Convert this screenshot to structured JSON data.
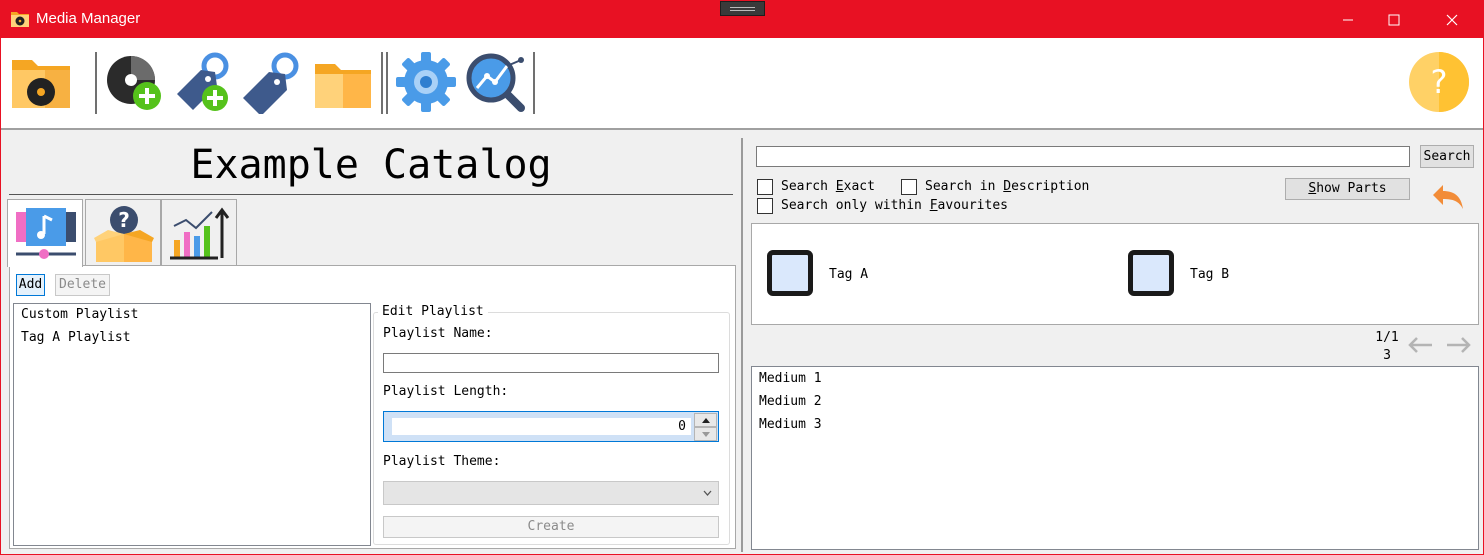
{
  "window": {
    "title": "Media Manager",
    "accent_color": "#e81123"
  },
  "toolbar": {
    "items": [
      {
        "name": "open-catalog",
        "icon": "folder-disc-icon"
      },
      {
        "name": "add-medium",
        "icon": "disc-plus-icon"
      },
      {
        "name": "add-tag",
        "icon": "tag-plus-icon"
      },
      {
        "name": "tags",
        "icon": "tag-icon"
      },
      {
        "name": "open-folder",
        "icon": "folder-icon"
      },
      {
        "name": "settings",
        "icon": "gear-icon"
      },
      {
        "name": "analyze",
        "icon": "magnifier-graph-icon"
      },
      {
        "name": "help",
        "icon": "help-icon"
      }
    ]
  },
  "catalog": {
    "title": "Example Catalog"
  },
  "tabs": [
    {
      "name": "playlists",
      "icon": "playlist-music-icon",
      "active": true
    },
    {
      "name": "unknown-parts",
      "icon": "question-box-icon",
      "active": false
    },
    {
      "name": "statistics",
      "icon": "bar-chart-icon",
      "active": false
    }
  ],
  "playlists": {
    "add_label": "Add",
    "delete_label": "Delete",
    "items": [
      "Custom Playlist",
      "Tag A Playlist"
    ],
    "edit": {
      "legend": "Edit Playlist",
      "name_label": "Playlist Name:",
      "name_value": "",
      "length_label": "Playlist Length:",
      "length_value": "0",
      "theme_label": "Playlist Theme:",
      "theme_value": "",
      "create_label": "Create"
    }
  },
  "search": {
    "query": "",
    "button_label": "Search",
    "exact_label_pre": "Search ",
    "exact_label_key": "E",
    "exact_label_post": "xact",
    "desc_label_pre": "Search in ",
    "desc_label_key": "D",
    "desc_label_post": "escription",
    "fav_label_pre": "Search only within ",
    "fav_label_key": "F",
    "fav_label_post": "avourites",
    "show_parts_key": "S",
    "show_parts_rest": "how Parts"
  },
  "tags": [
    {
      "label": "Tag A",
      "checked": false
    },
    {
      "label": "Tag B",
      "checked": false
    }
  ],
  "pager": {
    "line1": "1/1",
    "line2": "3"
  },
  "media": [
    "Medium 1",
    "Medium 2",
    "Medium 3"
  ]
}
